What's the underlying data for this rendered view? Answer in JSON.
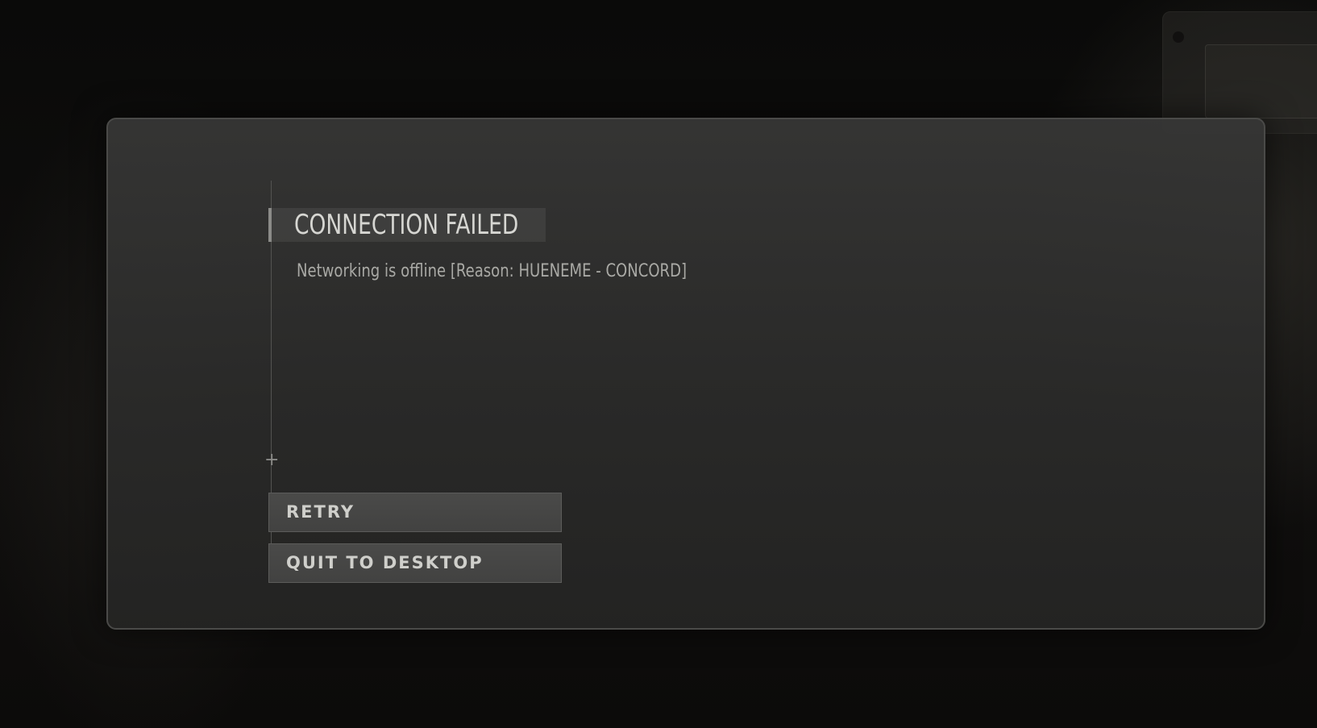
{
  "dialog": {
    "title": "CONNECTION FAILED",
    "message": "Networking is offline [Reason: HUENEME - CONCORD]",
    "icons": {
      "corner_marker": "plus-icon"
    },
    "buttons": {
      "retry_label": "RETRY",
      "quit_label": "QUIT TO DESKTOP"
    }
  },
  "colors": {
    "modal_background": "#2e2e2d",
    "button_background": "#454544",
    "title_text": "#d6d6d2",
    "message_text": "#a9a9a5"
  }
}
